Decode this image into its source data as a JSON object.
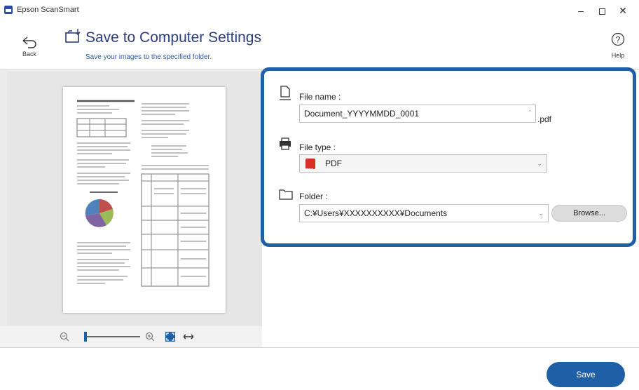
{
  "window": {
    "title": "Epson ScanSmart"
  },
  "header": {
    "back_label": "Back",
    "title": "Save to Computer Settings",
    "subtitle": "Save your images to the specified folder.",
    "help_label": "Help"
  },
  "settings": {
    "file_name": {
      "label": "File name :",
      "value": "Document_YYYYMMDD_0001",
      "extension": ".pdf"
    },
    "file_type": {
      "label": "File type :",
      "value": "PDF"
    },
    "folder": {
      "label": "Folder :",
      "value": "C:¥Users¥XXXXXXXXXX¥Documents",
      "browse_label": "Browse..."
    }
  },
  "footer": {
    "save_label": "Save"
  },
  "colors": {
    "accent": "#1f5fa5",
    "title_text": "#2c3e7d",
    "pdf_red": "#d93025"
  },
  "icons": [
    "back-arrow-icon",
    "save-folder-icon",
    "help-icon",
    "document-icon",
    "printer-icon",
    "folder-icon",
    "pdf-icon",
    "zoom-out-icon",
    "zoom-in-icon",
    "fit-page-icon",
    "expand-icon",
    "minimize-icon",
    "maximize-icon",
    "close-icon"
  ]
}
